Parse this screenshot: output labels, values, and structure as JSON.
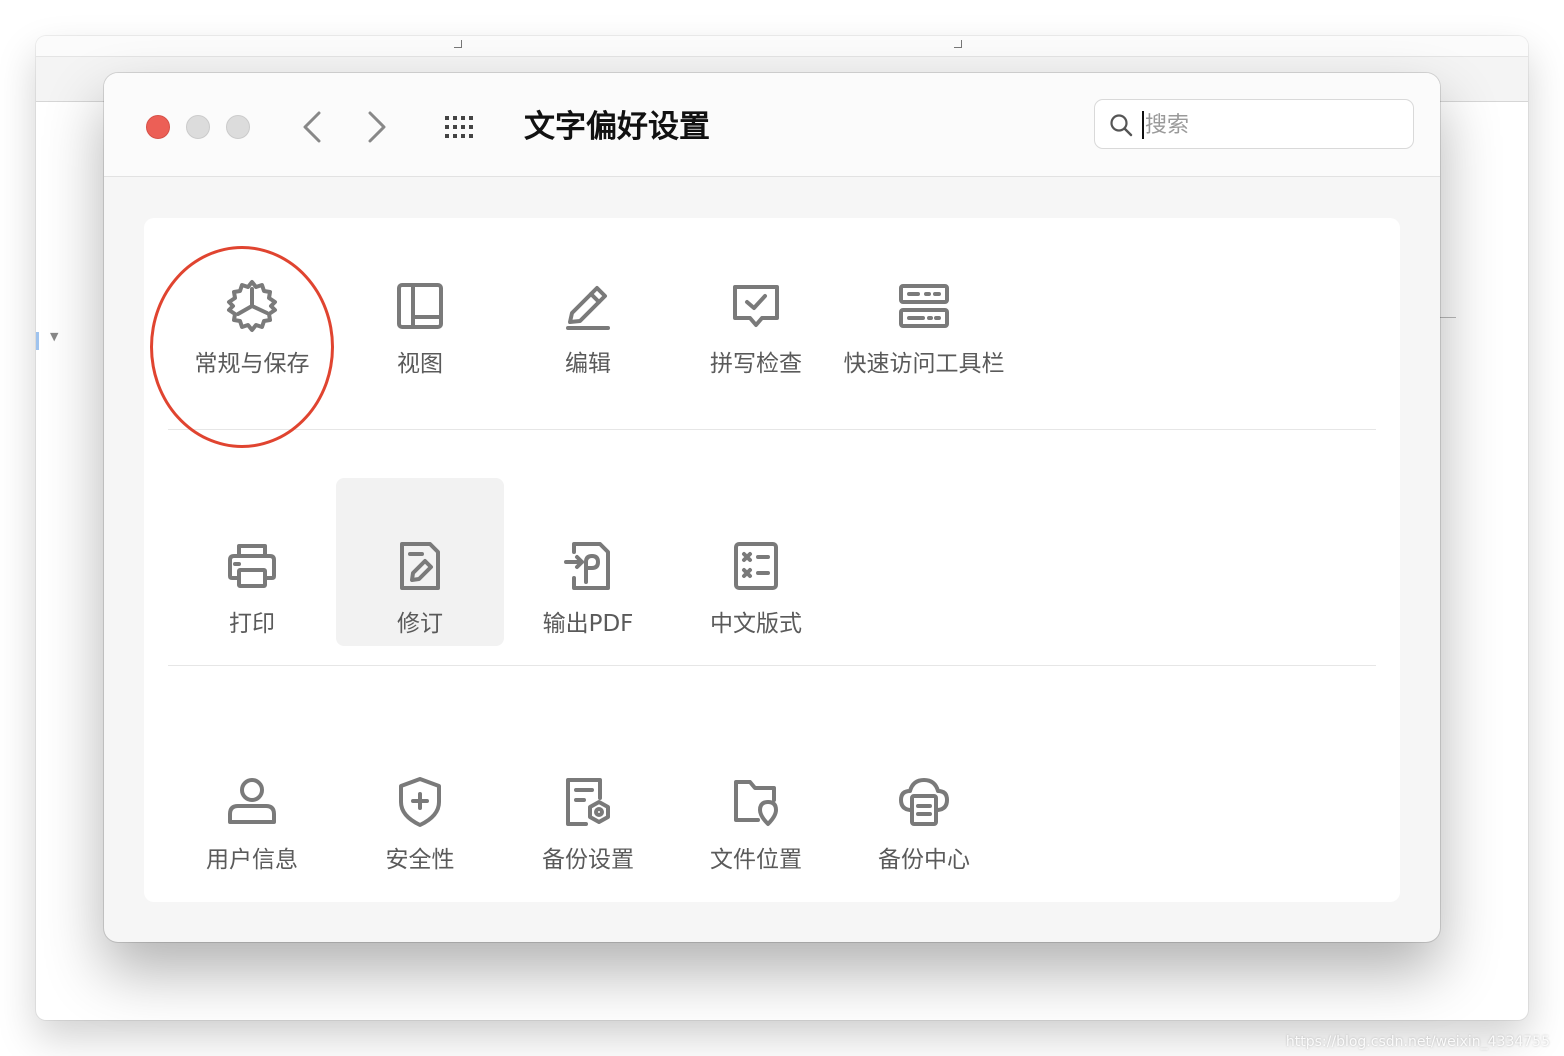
{
  "window": {
    "title": "文字偏好设置"
  },
  "search": {
    "placeholder": "搜索",
    "value": ""
  },
  "rows": [
    [
      {
        "label": "常规与保存",
        "icon": "gear-icon",
        "selected": false
      },
      {
        "label": "视图",
        "icon": "view-layout-icon",
        "selected": false
      },
      {
        "label": "编辑",
        "icon": "pencil-icon",
        "selected": false
      },
      {
        "label": "拼写检查",
        "icon": "spell-check-icon",
        "selected": false
      },
      {
        "label": "快速访问工具栏",
        "icon": "toolbar-icon",
        "selected": false
      }
    ],
    [
      {
        "label": "打印",
        "icon": "printer-icon",
        "selected": false
      },
      {
        "label": "修订",
        "icon": "revision-icon",
        "selected": true
      },
      {
        "label": "输出PDF",
        "icon": "export-pdf-icon",
        "selected": false
      },
      {
        "label": "中文版式",
        "icon": "chinese-layout-icon",
        "selected": false
      }
    ],
    [
      {
        "label": "用户信息",
        "icon": "user-icon",
        "selected": false
      },
      {
        "label": "安全性",
        "icon": "shield-icon",
        "selected": false
      },
      {
        "label": "备份设置",
        "icon": "backup-settings-icon",
        "selected": false
      },
      {
        "label": "文件位置",
        "icon": "folder-location-icon",
        "selected": false
      },
      {
        "label": "备份中心",
        "icon": "backup-center-icon",
        "selected": false
      }
    ]
  ],
  "watermark": "https://blog.csdn.net/weixin_4334755",
  "colors": {
    "close_light": "#ec5f56",
    "annotation": "#e04430",
    "icon": "#7a7a7a",
    "label": "#5a5a5a"
  }
}
